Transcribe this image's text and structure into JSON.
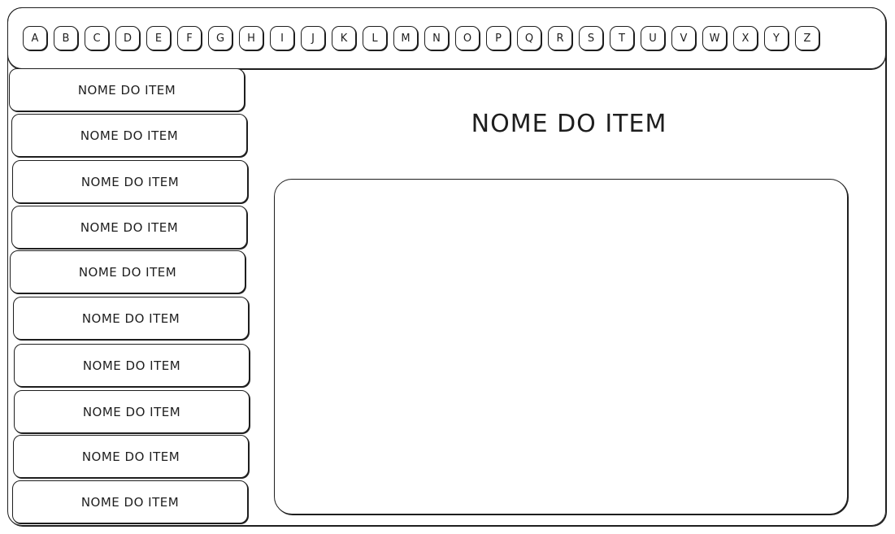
{
  "alphabet": [
    "A",
    "B",
    "C",
    "D",
    "E",
    "F",
    "G",
    "H",
    "I",
    "J",
    "K",
    "L",
    "M",
    "N",
    "O",
    "P",
    "Q",
    "R",
    "S",
    "T",
    "U",
    "V",
    "W",
    "X",
    "Y",
    "Z"
  ],
  "sidebar": {
    "items": [
      {
        "label": "NOME DO ITEM"
      },
      {
        "label": "NOME DO ITEM"
      },
      {
        "label": "NOME DO ITEM"
      },
      {
        "label": "NOME DO ITEM"
      },
      {
        "label": "NOME DO ITEM"
      },
      {
        "label": "NOME DO ITEM"
      },
      {
        "label": "NOME DO ITEM"
      },
      {
        "label": "NOME DO ITEM"
      },
      {
        "label": "NOME DO ITEM"
      },
      {
        "label": "NOME DO ITEM"
      }
    ]
  },
  "detail": {
    "title": "NOME DO ITEM"
  },
  "colors": {
    "stroke": "#1e1e1e",
    "background": "#ffffff"
  }
}
